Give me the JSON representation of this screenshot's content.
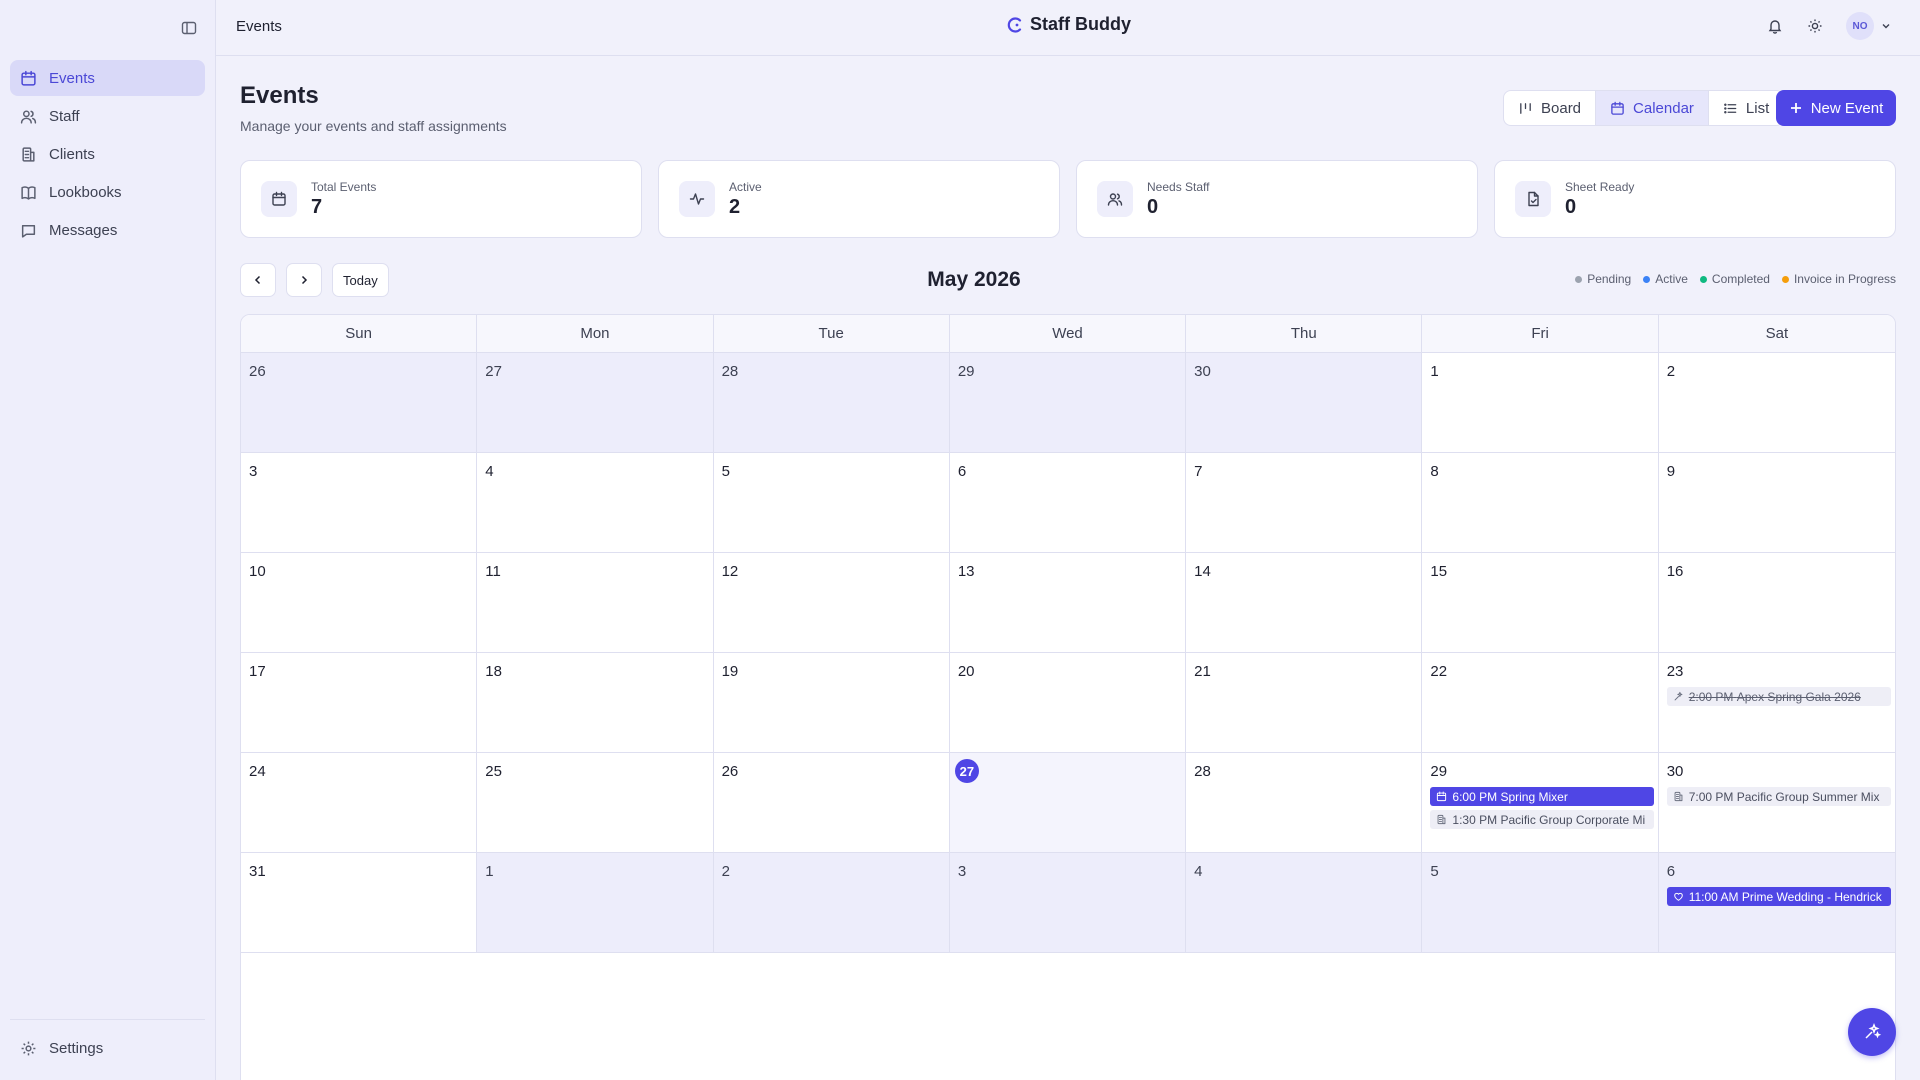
{
  "header": {
    "title": "Events",
    "logo_text": "Staff Buddy",
    "avatar_initials": "NO"
  },
  "sidebar": {
    "items": [
      {
        "label": "Events",
        "icon": "calendar-icon",
        "active": true
      },
      {
        "label": "Staff",
        "icon": "users-icon",
        "active": false
      },
      {
        "label": "Clients",
        "icon": "building-icon",
        "active": false
      },
      {
        "label": "Lookbooks",
        "icon": "book-icon",
        "active": false
      },
      {
        "label": "Messages",
        "icon": "message-icon",
        "active": false
      }
    ],
    "settings_label": "Settings"
  },
  "page": {
    "title": "Events",
    "subtitle": "Manage your events and staff assignments"
  },
  "views": [
    {
      "label": "Board",
      "icon": "board-icon",
      "active": false
    },
    {
      "label": "Calendar",
      "icon": "calendar-icon",
      "active": true
    },
    {
      "label": "List",
      "icon": "list-icon",
      "active": false
    }
  ],
  "new_event_label": "New Event",
  "stats": [
    {
      "label": "Total Events",
      "value": "7",
      "icon": "calendar-icon"
    },
    {
      "label": "Active",
      "value": "2",
      "icon": "activity-icon"
    },
    {
      "label": "Needs Staff",
      "value": "0",
      "icon": "users-icon"
    },
    {
      "label": "Sheet Ready",
      "value": "0",
      "icon": "file-check-icon"
    }
  ],
  "calendar": {
    "month_title": "May 2026",
    "today_label": "Today",
    "legend": [
      {
        "label": "Pending",
        "color": "#9ca3af"
      },
      {
        "label": "Active",
        "color": "#3b82f6"
      },
      {
        "label": "Completed",
        "color": "#10b981"
      },
      {
        "label": "Invoice in Progress",
        "color": "#f59e0b"
      }
    ],
    "weekdays": [
      "Sun",
      "Mon",
      "Tue",
      "Wed",
      "Thu",
      "Fri",
      "Sat"
    ],
    "days": [
      {
        "day": "26",
        "outside": true
      },
      {
        "day": "27",
        "outside": true
      },
      {
        "day": "28",
        "outside": true
      },
      {
        "day": "29",
        "outside": true
      },
      {
        "day": "30",
        "outside": true
      },
      {
        "day": "1"
      },
      {
        "day": "2"
      },
      {
        "day": "3"
      },
      {
        "day": "4"
      },
      {
        "day": "5"
      },
      {
        "day": "6"
      },
      {
        "day": "7"
      },
      {
        "day": "8"
      },
      {
        "day": "9"
      },
      {
        "day": "10"
      },
      {
        "day": "11"
      },
      {
        "day": "12"
      },
      {
        "day": "13"
      },
      {
        "day": "14"
      },
      {
        "day": "15"
      },
      {
        "day": "16"
      },
      {
        "day": "17"
      },
      {
        "day": "18"
      },
      {
        "day": "19"
      },
      {
        "day": "20"
      },
      {
        "day": "21"
      },
      {
        "day": "22"
      },
      {
        "day": "23",
        "events": [
          {
            "time": "2:00 PM",
            "title": "Apex Spring Gala 2026",
            "status": "completed",
            "icon": "sparkle-icon"
          }
        ]
      },
      {
        "day": "24"
      },
      {
        "day": "25"
      },
      {
        "day": "26"
      },
      {
        "day": "27",
        "today": true
      },
      {
        "day": "28"
      },
      {
        "day": "29",
        "events": [
          {
            "time": "6:00 PM",
            "title": "Spring Mixer",
            "status": "active",
            "icon": "calendar-icon"
          },
          {
            "time": "1:30 PM",
            "title": "Pacific Group Corporate Mi",
            "status": "pending",
            "icon": "building-icon"
          }
        ]
      },
      {
        "day": "30",
        "events": [
          {
            "time": "7:00 PM",
            "title": "Pacific Group Summer Mix",
            "status": "pending",
            "icon": "building-icon"
          }
        ]
      },
      {
        "day": "31"
      },
      {
        "day": "1",
        "outside": true
      },
      {
        "day": "2",
        "outside": true
      },
      {
        "day": "3",
        "outside": true
      },
      {
        "day": "4",
        "outside": true
      },
      {
        "day": "5",
        "outside": true
      },
      {
        "day": "6",
        "outside": true,
        "events": [
          {
            "time": "11:00 AM",
            "title": "Prime Wedding - Hendrick",
            "status": "active",
            "icon": "heart-icon"
          }
        ]
      }
    ]
  }
}
